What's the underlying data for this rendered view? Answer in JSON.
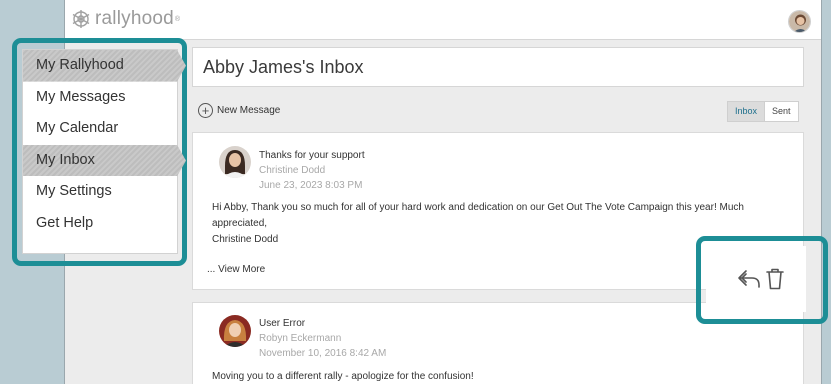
{
  "app": {
    "logo_text": "rallyhood",
    "logo_mark": "®"
  },
  "sidebar": {
    "items": [
      {
        "label": "My Rallyhood",
        "active": true
      },
      {
        "label": "My Messages",
        "active": false
      },
      {
        "label": "My Calendar",
        "active": false
      },
      {
        "label": "My Inbox",
        "active": true
      },
      {
        "label": "My Settings",
        "active": false
      },
      {
        "label": "Get Help",
        "active": false
      }
    ]
  },
  "main": {
    "title": "Abby James's Inbox",
    "new_message_label": "New Message",
    "plus_glyph": "+",
    "toggle": {
      "inbox": "Inbox",
      "sent": "Sent"
    }
  },
  "messages": [
    {
      "subject": "Thanks for your support",
      "sender": "Christine Dodd",
      "date": "June 23, 2023 8:03 PM",
      "body_line1": "Hi Abby, Thank you so much for all of your hard work and dedication on our Get Out The Vote Campaign this year! Much appreciated,",
      "body_line2": "Christine Dodd",
      "view_more": "... View More"
    },
    {
      "subject": "User Error",
      "sender": "Robyn Eckermann",
      "date": "November 10, 2016 8:42 AM",
      "body_line1": "Moving you to a different rally - apologize for the confusion!"
    }
  ],
  "icons": {
    "logo": "snowflake-logo-icon",
    "reply": "reply-icon",
    "trash": "trash-icon"
  },
  "colors": {
    "highlight": "#1d8e96",
    "background": "#b9ccd3",
    "active_tab_text": "#1d6f8c"
  }
}
